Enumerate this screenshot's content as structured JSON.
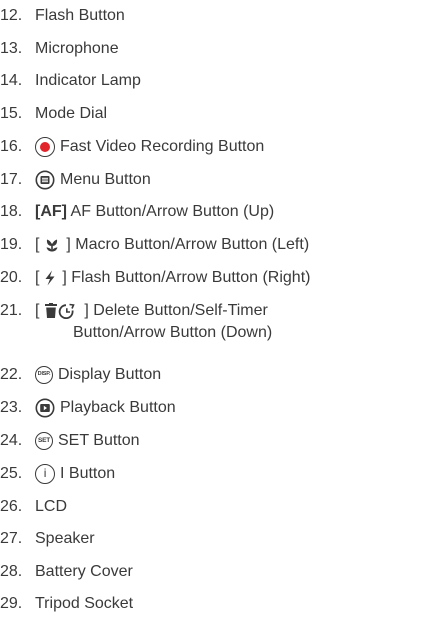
{
  "colors": {
    "text": "#3a3a3a",
    "record": "#e0242a"
  },
  "items": [
    {
      "num": "12.",
      "label": "Flash Button"
    },
    {
      "num": "13.",
      "label": "Microphone"
    },
    {
      "num": "14.",
      "label": "Indicator Lamp"
    },
    {
      "num": "15.",
      "label": "Mode Dial"
    },
    {
      "num": "16.",
      "icon": "record-dot-icon",
      "label": "Fast Video Recording Button"
    },
    {
      "num": "17.",
      "icon": "menu-icon",
      "label": "Menu Button"
    },
    {
      "num": "18.",
      "prefix": "[AF]",
      "label": "AF Button/Arrow Button (Up)"
    },
    {
      "num": "19.",
      "prefix_open": "[",
      "prefix_close": "]",
      "icon": "macro-flower-icon",
      "label": "Macro Button/Arrow Button (Left)"
    },
    {
      "num": "20.",
      "prefix_open": "[",
      "prefix_close": "]",
      "icon": "flash-bolt-icon",
      "label": "Flash Button/Arrow Button (Right)"
    },
    {
      "num": "21.",
      "prefix_open": "[",
      "prefix_close": "]",
      "icon": "delete-selftimer-icon",
      "label": "Delete Button/Self-Timer",
      "label_cont": "Button/Arrow Button (Down)"
    },
    {
      "num": "22.",
      "icon": "disp-icon",
      "icon_text": "DISP.",
      "label": "Display Button"
    },
    {
      "num": "23.",
      "icon": "playback-icon",
      "label": "Playback Button"
    },
    {
      "num": "24.",
      "icon": "set-icon",
      "icon_text": "SET",
      "label": "SET Button"
    },
    {
      "num": "25.",
      "icon": "info-i-icon",
      "icon_text": "i",
      "label": "I Button"
    },
    {
      "num": "26.",
      "label": "LCD"
    },
    {
      "num": "27.",
      "label": "Speaker"
    },
    {
      "num": "28.",
      "label": "Battery Cover"
    },
    {
      "num": "29.",
      "label": "Tripod Socket"
    }
  ]
}
